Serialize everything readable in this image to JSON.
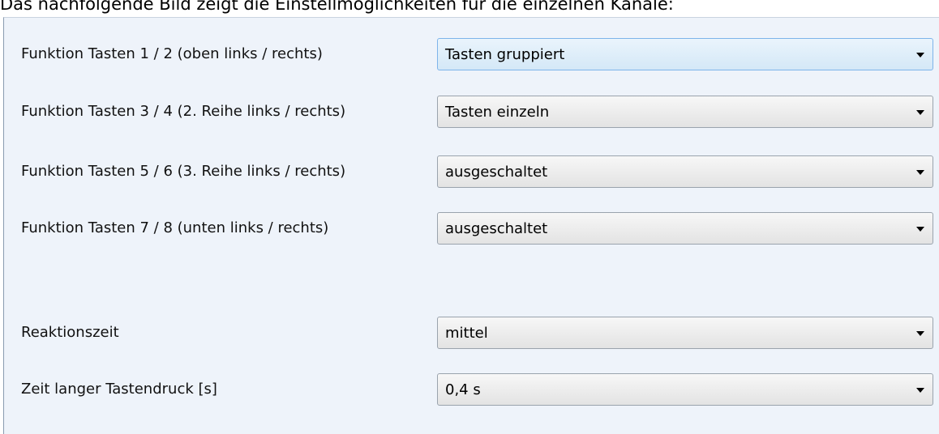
{
  "caption": "Das nachfolgende Bild zeigt die Einstellmöglichkeiten für die einzelnen Kanäle:",
  "settings": [
    {
      "label": "Funktion Tasten 1 / 2 (oben links / rechts)",
      "value": "Tasten gruppiert"
    },
    {
      "label": "Funktion Tasten 3 / 4 (2. Reihe links / rechts)",
      "value": "Tasten einzeln"
    },
    {
      "label": "Funktion Tasten 5 / 6 (3. Reihe links / rechts)",
      "value": "ausgeschaltet"
    },
    {
      "label": "Funktion Tasten 7 / 8 (unten links / rechts)",
      "value": "ausgeschaltet"
    },
    {
      "label": "Reaktionszeit",
      "value": "mittel"
    },
    {
      "label": "Zeit langer Tastendruck [s]",
      "value": "0,4 s"
    }
  ],
  "colors": {
    "panel_background": "#eef3fa",
    "focused_select": "#d4e8f7"
  },
  "icons": {
    "dropdown": "chevron-down-icon"
  }
}
